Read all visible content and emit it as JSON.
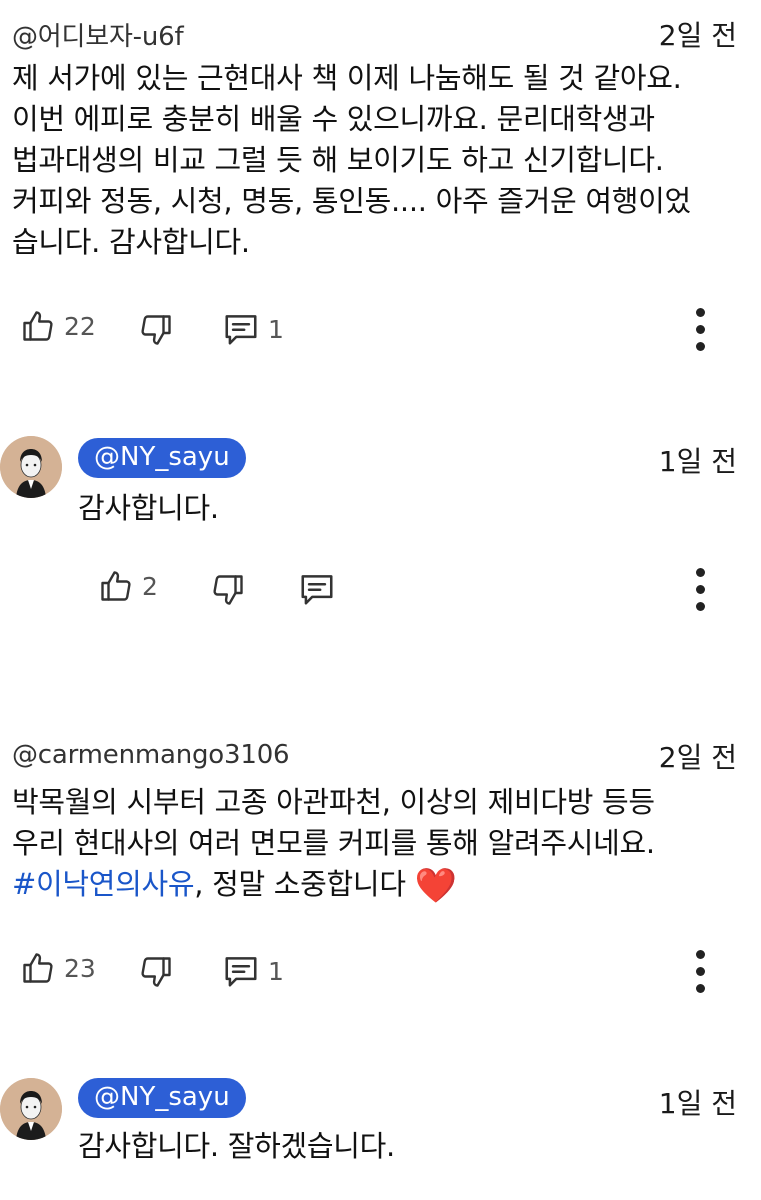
{
  "comments": [
    {
      "handle": "@어디보자-u6f",
      "time": "2일 전",
      "lines": [
        "제 서가에 있는 근현대사 책 이제 나눔해도 될 것 같아요.",
        "이번 에피로 충분히 배울 수 있으니까요. 문리대학생과",
        "법과대생의 비교 그럴 듯 해 보이기도 하고 신기합니다.",
        "커피와 정동, 시청, 명동, 통인동.... 아주 즐거운 여행이었",
        "습니다. 감사합니다."
      ],
      "likes": "22",
      "replies": "1"
    },
    {
      "handle": "@carmenmango3106",
      "time": "2일 전",
      "lines": [
        "박목월의 시부터 고종 아관파천, 이상의 제비다방 등등",
        "우리 현대사의 여러 면모를 커피를 통해 알려주시네요."
      ],
      "last_line_hashtag": "#이낙연의사유",
      "last_line_rest": ", 정말 소중합니다 ",
      "last_line_emoji": "❤️",
      "likes": "23",
      "replies": "1"
    }
  ],
  "replies": [
    {
      "handle": "@NY_sayu",
      "time": "1일 전",
      "text": "감사합니다.",
      "likes": "2"
    },
    {
      "handle": "@NY_sayu",
      "time": "1일 전",
      "text": "감사합니다. 잘하겠습니다."
    }
  ],
  "icons": {
    "like": "thumbs-up-icon",
    "dislike": "thumbs-down-icon",
    "reply": "comment-icon",
    "menu": "more-vertical-icon"
  },
  "colors": {
    "hashtag": "#1a56c9",
    "pill": "#2d5fd6",
    "heart": "#e0243a"
  }
}
